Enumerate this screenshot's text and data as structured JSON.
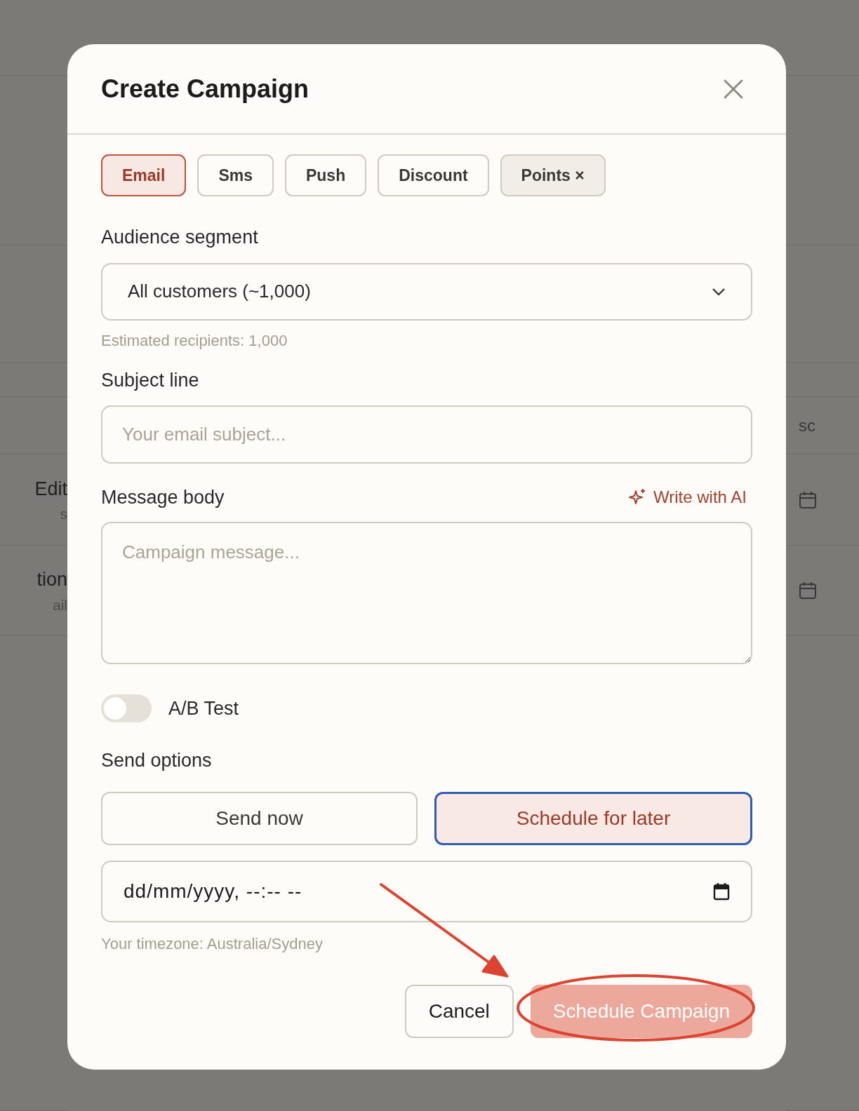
{
  "background": {
    "column_header": "sc",
    "rows": [
      {
        "title": "Edit",
        "subtitle": "s",
        "calendar": true
      },
      {
        "title": "tion",
        "subtitle": "ail",
        "calendar": true
      }
    ]
  },
  "dialog": {
    "title": "Create Campaign",
    "campaign_types": [
      {
        "label": "Email",
        "selected": true,
        "kind": "preset"
      },
      {
        "label": "Sms",
        "selected": false,
        "kind": "preset"
      },
      {
        "label": "Push",
        "selected": false,
        "kind": "preset"
      },
      {
        "label": "Discount",
        "selected": false,
        "kind": "preset"
      },
      {
        "label": "Points ×",
        "selected": false,
        "kind": "custom"
      }
    ],
    "audience": {
      "label": "Audience segment",
      "value": "All customers (~1,000)",
      "help": "Estimated recipients: 1,000"
    },
    "subject": {
      "label": "Subject line",
      "placeholder": "Your email subject..."
    },
    "message": {
      "label": "Message body",
      "ai_action": "Write with AI",
      "placeholder": "Campaign message..."
    },
    "ab_test": {
      "label": "A/B Test",
      "on": false
    },
    "send_options": {
      "label": "Send options",
      "options": [
        {
          "label": "Send now",
          "selected": false
        },
        {
          "label": "Schedule for later",
          "selected": true
        }
      ]
    },
    "schedule": {
      "value": "dd/mm/yyyy, --:-- --",
      "help": "Your timezone: Australia/Sydney"
    },
    "buttons": [
      {
        "label": "Cancel",
        "kind": "secondary",
        "disabled": false
      },
      {
        "label": "Schedule Campaign",
        "kind": "primary",
        "disabled": true
      }
    ]
  },
  "annotations": {
    "arrow": {
      "color": "#db4430"
    },
    "ellipse": {
      "color": "#db4430"
    }
  }
}
